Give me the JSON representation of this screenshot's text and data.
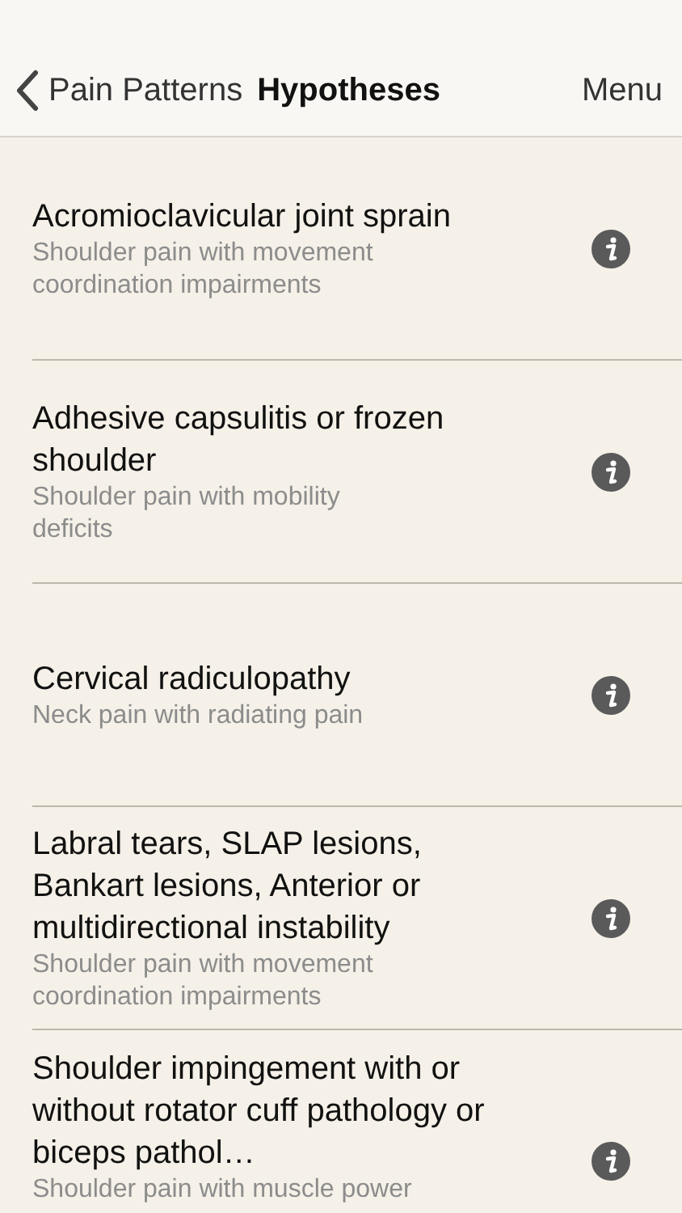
{
  "nav_bar": {
    "back_label": "Pain Patterns",
    "title": "Hypotheses",
    "menu_label": "Menu"
  },
  "hypotheses": [
    {
      "title": "Acromioclavicular joint sprain",
      "subtitle": "Shoulder pain with movement coordination impairments"
    },
    {
      "title": "Adhesive capsulitis or frozen shoulder",
      "subtitle": "Shoulder pain with mobility deficits"
    },
    {
      "title": "Cervical radiculopathy",
      "subtitle": "Neck pain with radiating pain"
    },
    {
      "title": "Labral tears, SLAP lesions, Bankart lesions, Anterior or multidirectional instability",
      "subtitle": "Shoulder pain with movement coordination impairments"
    },
    {
      "title": "Shoulder impingement with or without rotator cuff pathology or biceps pathol…",
      "subtitle": "Shoulder pain with muscle power"
    }
  ]
}
